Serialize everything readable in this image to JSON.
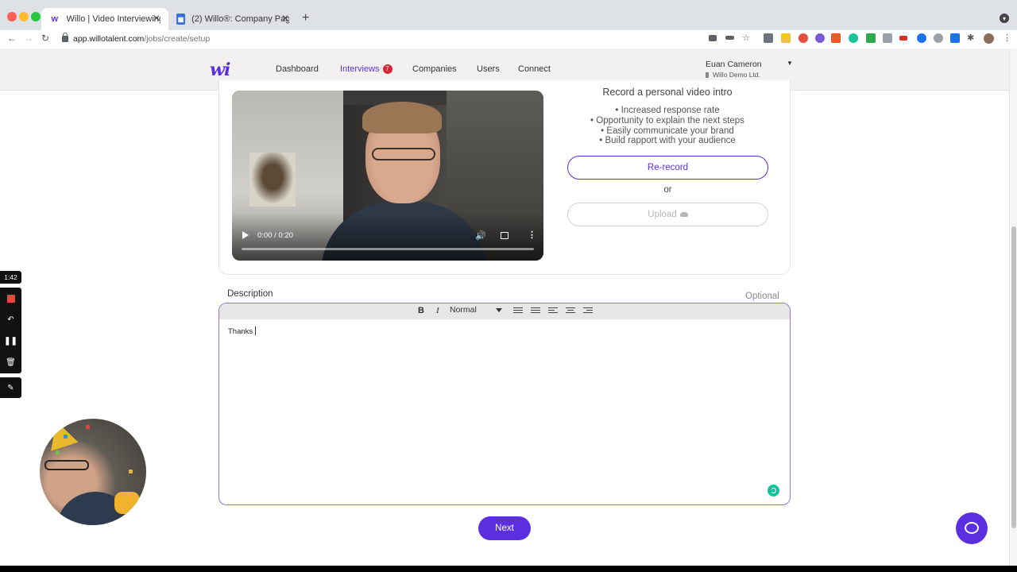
{
  "browser": {
    "tabs": [
      {
        "title": "Willo | Video Interviewing",
        "active": true
      },
      {
        "title": "(2) Willo®: Company Page Adm",
        "active": false
      }
    ],
    "url_host": "app.willotalent.com",
    "url_path": "/jobs/create/setup"
  },
  "nav": {
    "logo": "wi",
    "links": [
      "Dashboard",
      "Interviews",
      "Companies",
      "Users",
      "Connect"
    ],
    "interviews_badge": "7",
    "user_name": "Euan Cameron",
    "user_company": "Willo Demo Ltd."
  },
  "video": {
    "time": "0:00 / 0:20"
  },
  "intro": {
    "title": "Record a personal video intro",
    "bullets": [
      "• Increased response rate",
      "• Opportunity to explain the next steps",
      "• Easily communicate your brand",
      "• Build rapport with your audience"
    ],
    "rerecord_label": "Re-record",
    "or_text": "or",
    "upload_label": "Upload"
  },
  "description": {
    "label": "Description",
    "optional": "Optional",
    "toolbar": {
      "bold": "B",
      "italic": "I",
      "format": "Normal"
    },
    "content": "Thanks"
  },
  "actions": {
    "next_label": "Next"
  },
  "recorder": {
    "time": "1:42"
  },
  "colors": {
    "brand": "#5b2fe0",
    "badge": "#d6263b",
    "grammarly": "#15c39a"
  }
}
